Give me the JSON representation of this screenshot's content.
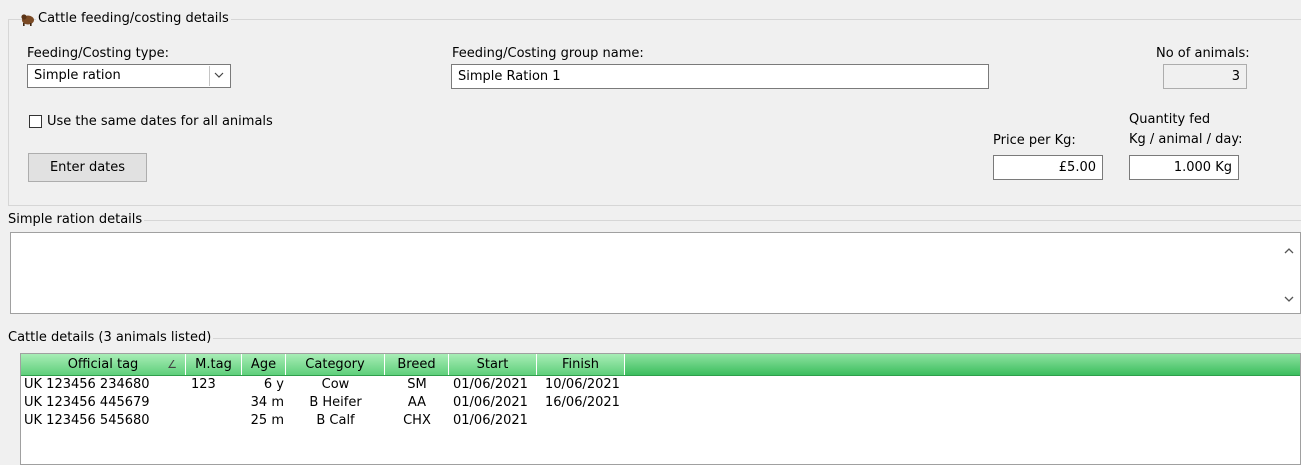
{
  "feeding_section": {
    "title": "Cattle feeding/costing details",
    "type_label": "Feeding/Costing type:",
    "type_value": "Simple ration",
    "group_name_label": "Feeding/Costing group name:",
    "group_name_value": "Simple Ration 1",
    "num_animals_label": "No of animals:",
    "num_animals_value": "3",
    "same_dates_label": "Use the same dates for all animals",
    "same_dates_checked": false,
    "enter_dates_label": "Enter dates",
    "price_label": "Price per Kg:",
    "price_value": "£5.00",
    "quantity_label_1": "Quantity fed",
    "quantity_label_2": "Kg / animal / day:",
    "quantity_value": "1.000 Kg"
  },
  "ration_section": {
    "title": "Simple ration details",
    "text": ""
  },
  "cattle_section": {
    "title": "Cattle details (3 animals listed)",
    "columns": [
      "Official tag",
      "M.tag",
      "Age",
      "Category",
      "Breed",
      "Start",
      "Finish"
    ],
    "sort_indicator": "∠",
    "rows": [
      {
        "official_tag": "UK 123456 234680",
        "mtag": "123",
        "age": "6 y",
        "category": "Cow",
        "breed": "SM",
        "start": "01/06/2021",
        "finish": "10/06/2021"
      },
      {
        "official_tag": "UK 123456 445679",
        "mtag": "",
        "age": "34 m",
        "category": "B Heifer",
        "breed": "AA",
        "start": "01/06/2021",
        "finish": "16/06/2021"
      },
      {
        "official_tag": "UK 123456 545680",
        "mtag": "",
        "age": "25 m",
        "category": "B Calf",
        "breed": "CHX",
        "start": "01/06/2021",
        "finish": ""
      }
    ]
  },
  "colors": {
    "header_green": "#5fcf7b",
    "background": "#f0f0f0"
  }
}
